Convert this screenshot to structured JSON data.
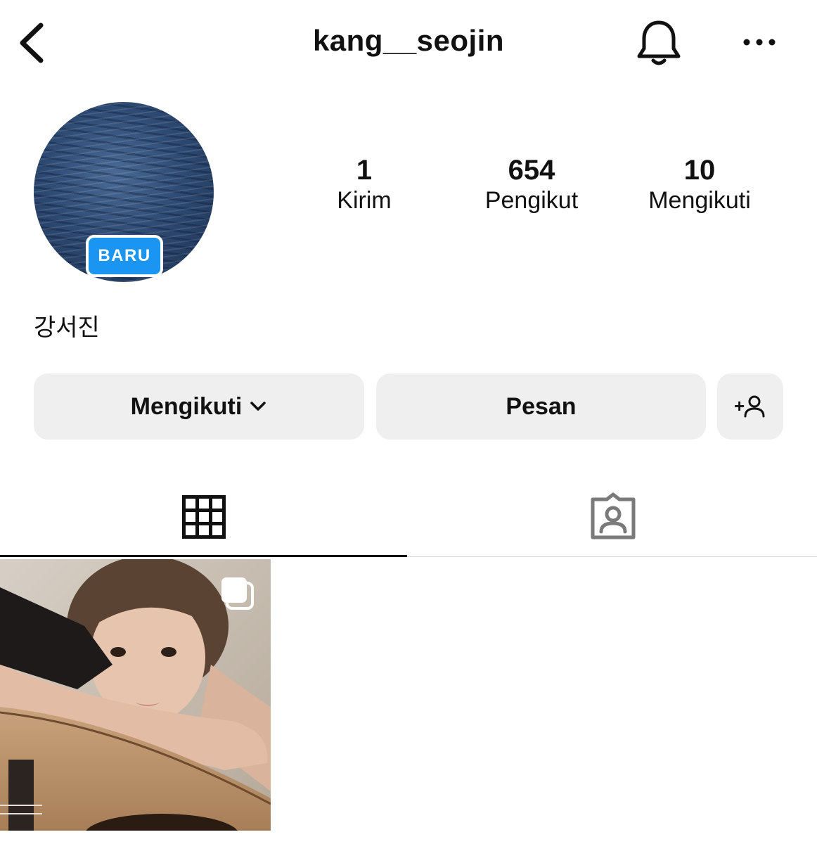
{
  "header": {
    "username": "kang__seojin"
  },
  "profile": {
    "new_badge": "BARU",
    "display_name": "강서진",
    "stats": {
      "posts": {
        "count": "1",
        "label": "Kirim"
      },
      "followers": {
        "count": "654",
        "label": "Pengikut"
      },
      "following": {
        "count": "10",
        "label": "Mengikuti"
      }
    }
  },
  "actions": {
    "following_label": "Mengikuti",
    "message_label": "Pesan",
    "add_user_glyph": "+"
  },
  "tabs": [
    {
      "icon": "grid-icon",
      "active": true
    },
    {
      "icon": "tagged-icon",
      "active": false
    }
  ],
  "colors": {
    "badge_blue": "#1b95f2",
    "button_bg": "#efefef",
    "text": "#111111",
    "divider": "#dbdbdb"
  },
  "icons": [
    "back-icon",
    "bell-icon",
    "more-icon",
    "chevron-down-icon",
    "add-user-icon",
    "grid-icon",
    "tagged-icon",
    "multiple-photos-icon"
  ]
}
